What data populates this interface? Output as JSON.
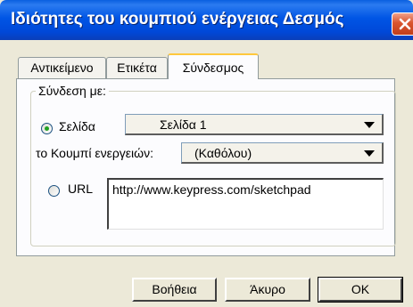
{
  "window": {
    "title": "Ιδιότητες του κουμπιού ενέργειας Δεσμός",
    "accent": "#0055E5"
  },
  "tabs": [
    {
      "label": "Αντικείμενο",
      "active": false
    },
    {
      "label": "Ετικέτα",
      "active": false
    },
    {
      "label": "Σύνδεσμος",
      "active": true
    }
  ],
  "link_group": {
    "label": "Σύνδεση με:",
    "page_option": {
      "label": "Σελίδα",
      "selected": true
    },
    "page_select": {
      "value": "Σελίδα 1"
    },
    "action_label": "το Κουμπί ενεργειών:",
    "action_select": {
      "value": "(Καθόλου)"
    },
    "url_option": {
      "label": "URL",
      "selected": false
    },
    "url_value": "http://www.keypress.com/sketchpad"
  },
  "buttons": {
    "help": "Βοήθεια",
    "cancel": "Άκυρο",
    "ok": "OK"
  }
}
